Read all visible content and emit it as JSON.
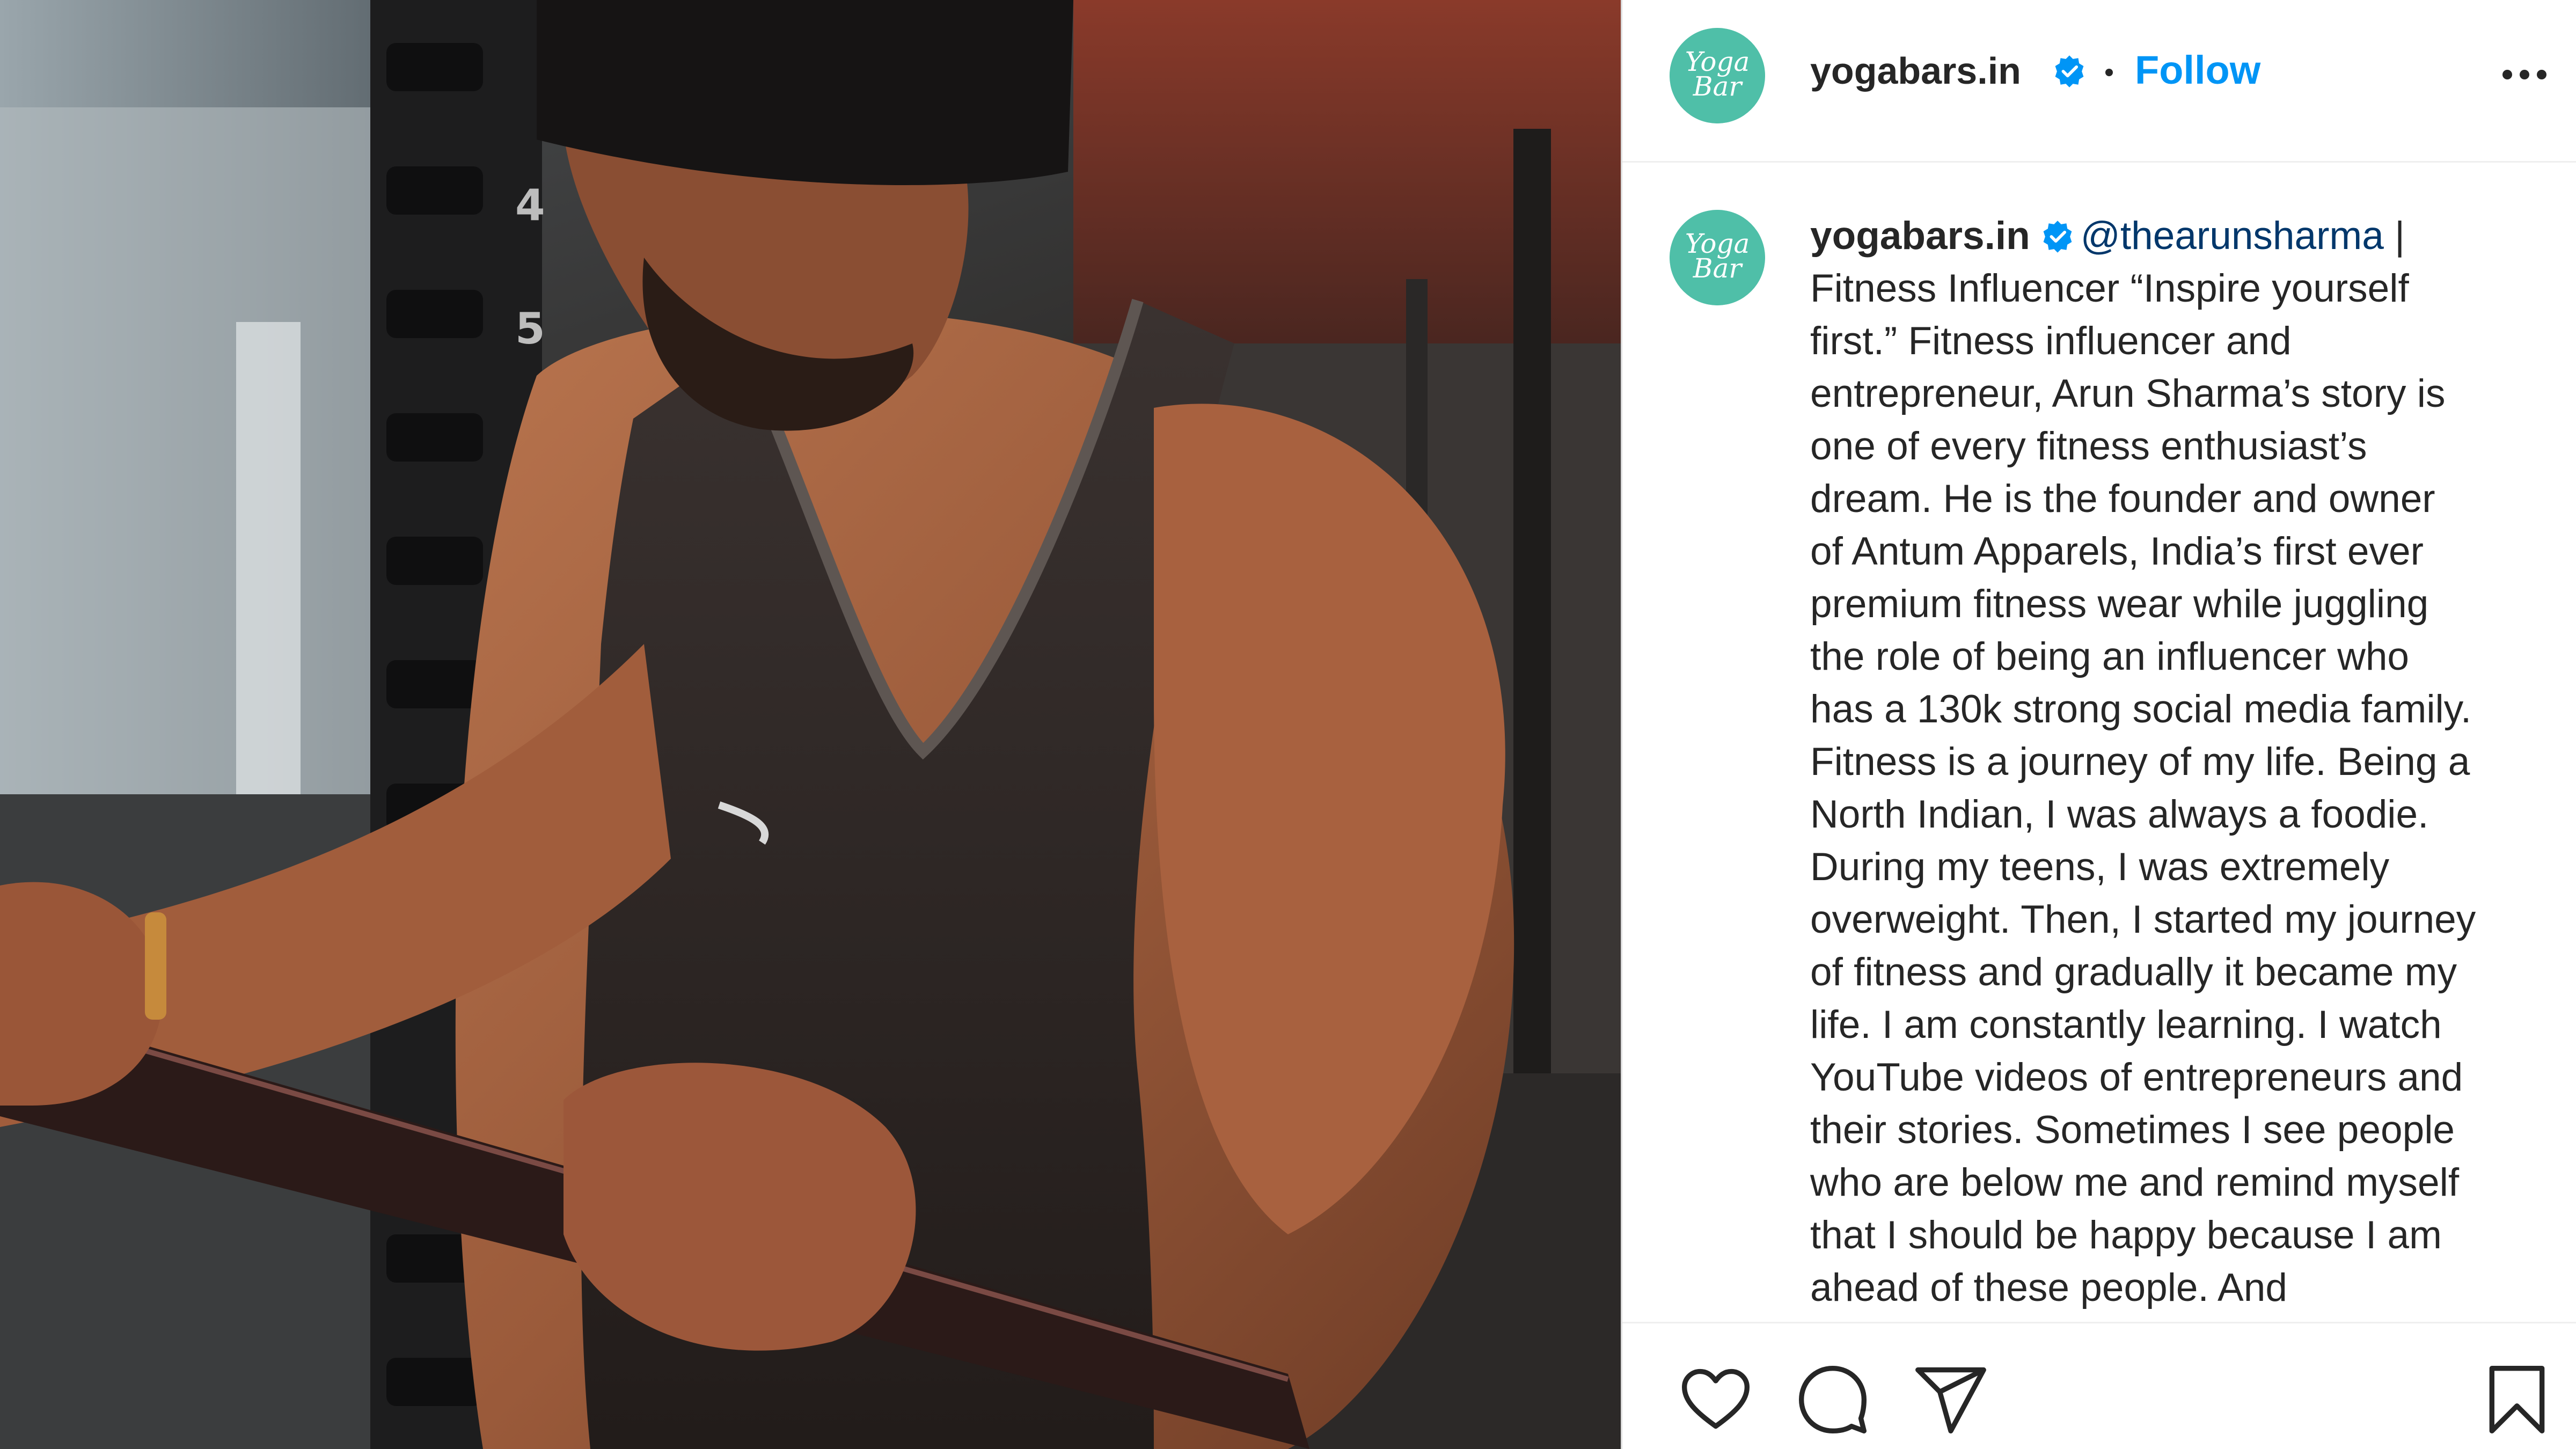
{
  "post": {
    "author": {
      "handle": "yogabars.in",
      "verified": true,
      "avatar": {
        "brand_color": "#4fbfa8",
        "icon": "yoga-bar-logo"
      }
    },
    "follow_label": "Follow",
    "follow_color": "#0095f6",
    "menu_icon": "more-horizontal-icon",
    "caption": {
      "handle": "yogabars.in",
      "mention": "@thearunsharma",
      "lines": [
        " |",
        "Fitness Influencer “Inspire yourself",
        "first.” Fitness influencer and",
        "entrepreneur, Arun Sharma’s story is",
        "one of every fitness enthusiast’s",
        "dream. He is the founder and owner",
        "of Antum Apparels, India’s first ever",
        "premium fitness wear while juggling",
        "the role of being an influencer who",
        "has a 130k strong social media family.",
        "Fitness is a journey of my life.  Being a",
        "North Indian, I was always a foodie.",
        "During my teens, I was extremely",
        "overweight. Then, I started my journey",
        "of fitness and gradually it became my",
        "life. I am constantly learning. I watch",
        "YouTube videos of entrepreneurs and",
        "their stories. Sometimes I see people",
        "who are below me and remind myself",
        "that I should be happy because I am",
        "ahead of these people. And"
      ]
    },
    "actions": {
      "like_icon": "heart-icon",
      "comment_icon": "comment-bubble-icon",
      "share_icon": "paper-plane-icon",
      "save_icon": "bookmark-icon"
    },
    "colors": {
      "text": "#262626",
      "mention": "#00376b",
      "verified": "#0095f6"
    }
  }
}
